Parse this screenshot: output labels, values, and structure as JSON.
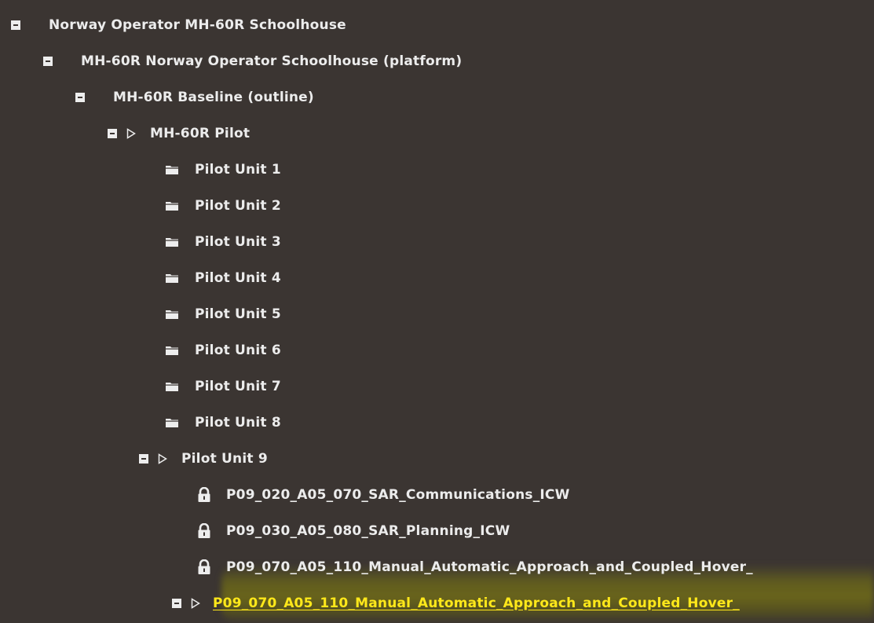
{
  "tree": {
    "nodes": [
      {
        "id": "n0",
        "label": "Norway Operator MH-60R Schoolhouse",
        "kind": "branch",
        "expanded": true
      },
      {
        "id": "n1",
        "label": "MH-60R Norway Operator Schoolhouse (platform)",
        "kind": "branch",
        "expanded": true
      },
      {
        "id": "n2",
        "label": "MH-60R Baseline (outline)",
        "kind": "branch",
        "expanded": true
      },
      {
        "id": "n3",
        "label": "MH-60R Pilot",
        "kind": "branch-play",
        "expanded": true
      },
      {
        "id": "n4",
        "label": "Pilot Unit 1",
        "kind": "folder"
      },
      {
        "id": "n5",
        "label": "Pilot Unit 2",
        "kind": "folder"
      },
      {
        "id": "n6",
        "label": "Pilot Unit 3",
        "kind": "folder"
      },
      {
        "id": "n7",
        "label": "Pilot Unit 4",
        "kind": "folder"
      },
      {
        "id": "n8",
        "label": "Pilot Unit 5",
        "kind": "folder"
      },
      {
        "id": "n9",
        "label": "Pilot Unit 6",
        "kind": "folder"
      },
      {
        "id": "n10",
        "label": "Pilot Unit 7",
        "kind": "folder"
      },
      {
        "id": "n11",
        "label": "Pilot Unit 8",
        "kind": "folder"
      },
      {
        "id": "n12",
        "label": "Pilot Unit 9",
        "kind": "branch-play",
        "expanded": true
      },
      {
        "id": "n13",
        "label": "P09_020_A05_070_SAR_Communications_ICW",
        "kind": "locked"
      },
      {
        "id": "n14",
        "label": "P09_030_A05_080_SAR_Planning_ICW",
        "kind": "locked"
      },
      {
        "id": "n15",
        "label": "P09_070_A05_110_Manual_Automatic_Approach_and_Coupled_Hover_",
        "kind": "locked"
      },
      {
        "id": "n16",
        "label": "P09_070_A05_110_Manual_Automatic_Approach_and_Coupled_Hover_",
        "kind": "branch-play",
        "expanded": true,
        "selected": true
      }
    ]
  },
  "colors": {
    "background": "#3b3532",
    "text": "#ececec",
    "selected_text": "#ffe81a",
    "highlight": "#6c671a"
  },
  "icons": {
    "collapse": "minus-box-icon",
    "expand_arrow": "triangle-right-outline-icon",
    "folder": "folder-icon",
    "lock": "lock-icon"
  }
}
